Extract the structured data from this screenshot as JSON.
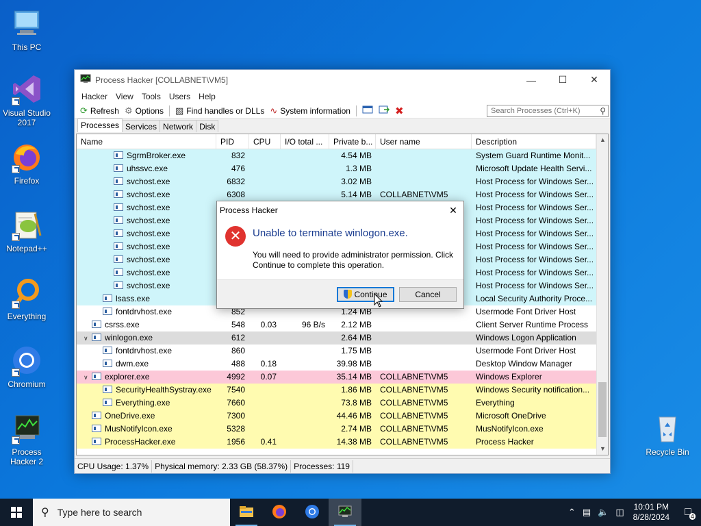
{
  "desktop": {
    "icons": [
      {
        "label": "This PC"
      },
      {
        "label": "Visual Studio 2017"
      },
      {
        "label": "Firefox"
      },
      {
        "label": "Notepad++"
      },
      {
        "label": "Everything"
      },
      {
        "label": "Chromium"
      },
      {
        "label": "Process Hacker 2"
      },
      {
        "label": "Recycle Bin"
      }
    ]
  },
  "window": {
    "title": "Process Hacker [COLLABNET\\VM5]",
    "menu": [
      "Hacker",
      "View",
      "Tools",
      "Users",
      "Help"
    ],
    "toolbar": {
      "refresh": "Refresh",
      "options": "Options",
      "find_handles": "Find handles or DLLs",
      "system_info": "System information"
    },
    "search_placeholder": "Search Processes (Ctrl+K)",
    "tabs": [
      "Processes",
      "Services",
      "Network",
      "Disk"
    ],
    "columns": [
      "Name",
      "PID",
      "CPU",
      "I/O total ...",
      "Private b...",
      "User name",
      "Description"
    ],
    "rows": [
      {
        "name": "SgrmBroker.exe",
        "pid": "832",
        "cpu": "",
        "io": "",
        "priv": "4.54 MB",
        "user": "",
        "desc": "System Guard Runtime Monit...",
        "indent": 3,
        "color": "#cff5fa"
      },
      {
        "name": "uhssvc.exe",
        "pid": "476",
        "cpu": "",
        "io": "",
        "priv": "1.3 MB",
        "user": "",
        "desc": "Microsoft Update Health Servi...",
        "indent": 3,
        "color": "#cff5fa"
      },
      {
        "name": "svchost.exe",
        "pid": "6832",
        "cpu": "",
        "io": "",
        "priv": "3.02 MB",
        "user": "",
        "desc": "Host Process for Windows Ser...",
        "indent": 3,
        "color": "#cff5fa"
      },
      {
        "name": "svchost.exe",
        "pid": "6308",
        "cpu": "",
        "io": "",
        "priv": "5.14 MB",
        "user": "COLLABNET\\VM5",
        "desc": "Host Process for Windows Ser...",
        "indent": 3,
        "color": "#cff5fa"
      },
      {
        "name": "svchost.exe",
        "pid": "",
        "cpu": "",
        "io": "",
        "priv": "",
        "user": "",
        "desc": "Host Process for Windows Ser...",
        "indent": 3,
        "color": "#cff5fa"
      },
      {
        "name": "svchost.exe",
        "pid": "",
        "cpu": "",
        "io": "",
        "priv": "",
        "user": "",
        "desc": "Host Process for Windows Ser...",
        "indent": 3,
        "color": "#cff5fa"
      },
      {
        "name": "svchost.exe",
        "pid": "",
        "cpu": "",
        "io": "",
        "priv": "",
        "user": "",
        "desc": "Host Process for Windows Ser...",
        "indent": 3,
        "color": "#cff5fa"
      },
      {
        "name": "svchost.exe",
        "pid": "",
        "cpu": "",
        "io": "",
        "priv": "",
        "user": "",
        "desc": "Host Process for Windows Ser...",
        "indent": 3,
        "color": "#cff5fa"
      },
      {
        "name": "svchost.exe",
        "pid": "",
        "cpu": "",
        "io": "",
        "priv": "",
        "user": "",
        "desc": "Host Process for Windows Ser...",
        "indent": 3,
        "color": "#cff5fa"
      },
      {
        "name": "svchost.exe",
        "pid": "",
        "cpu": "",
        "io": "",
        "priv": "",
        "user": "",
        "desc": "Host Process for Windows Ser...",
        "indent": 3,
        "color": "#cff5fa"
      },
      {
        "name": "svchost.exe",
        "pid": "",
        "cpu": "",
        "io": "",
        "priv": "",
        "user": "",
        "desc": "Host Process for Windows Ser...",
        "indent": 3,
        "color": "#cff5fa"
      },
      {
        "name": "lsass.exe",
        "pid": "",
        "cpu": "",
        "io": "",
        "priv": "",
        "user": "",
        "desc": "Local Security Authority Proce...",
        "indent": 2,
        "color": "#cff5fa"
      },
      {
        "name": "fontdrvhost.exe",
        "pid": "852",
        "cpu": "",
        "io": "",
        "priv": "1.24 MB",
        "user": "",
        "desc": "Usermode Font Driver Host",
        "indent": 2,
        "color": "#ffffff"
      },
      {
        "name": "csrss.exe",
        "pid": "548",
        "cpu": "0.03",
        "io": "96 B/s",
        "priv": "2.12 MB",
        "user": "",
        "desc": "Client Server Runtime Process",
        "indent": 1,
        "color": "#ffffff"
      },
      {
        "name": "winlogon.exe",
        "pid": "612",
        "cpu": "",
        "io": "",
        "priv": "2.64 MB",
        "user": "",
        "desc": "Windows Logon Application",
        "indent": 1,
        "color": "#dcdcdc",
        "expand": true
      },
      {
        "name": "fontdrvhost.exe",
        "pid": "860",
        "cpu": "",
        "io": "",
        "priv": "1.75 MB",
        "user": "",
        "desc": "Usermode Font Driver Host",
        "indent": 2,
        "color": "#ffffff"
      },
      {
        "name": "dwm.exe",
        "pid": "488",
        "cpu": "0.18",
        "io": "",
        "priv": "39.98 MB",
        "user": "",
        "desc": "Desktop Window Manager",
        "indent": 2,
        "color": "#ffffff"
      },
      {
        "name": "explorer.exe",
        "pid": "4992",
        "cpu": "0.07",
        "io": "",
        "priv": "35.14 MB",
        "user": "COLLABNET\\VM5",
        "desc": "Windows Explorer",
        "indent": 1,
        "color": "#fcc8d8",
        "expand": true
      },
      {
        "name": "SecurityHealthSystray.exe",
        "pid": "7540",
        "cpu": "",
        "io": "",
        "priv": "1.86 MB",
        "user": "COLLABNET\\VM5",
        "desc": "Windows Security notification...",
        "indent": 2,
        "color": "#fffbb0"
      },
      {
        "name": "Everything.exe",
        "pid": "7660",
        "cpu": "",
        "io": "",
        "priv": "73.8 MB",
        "user": "COLLABNET\\VM5",
        "desc": "Everything",
        "indent": 2,
        "color": "#fffbb0"
      },
      {
        "name": "OneDrive.exe",
        "pid": "7300",
        "cpu": "",
        "io": "",
        "priv": "44.46 MB",
        "user": "COLLABNET\\VM5",
        "desc": "Microsoft OneDrive",
        "indent": 1,
        "color": "#fffbb0"
      },
      {
        "name": "MusNotifyIcon.exe",
        "pid": "5328",
        "cpu": "",
        "io": "",
        "priv": "2.74 MB",
        "user": "COLLABNET\\VM5",
        "desc": "MusNotifyIcon.exe",
        "indent": 1,
        "color": "#fffbb0"
      },
      {
        "name": "ProcessHacker.exe",
        "pid": "1956",
        "cpu": "0.41",
        "io": "",
        "priv": "14.38 MB",
        "user": "COLLABNET\\VM5",
        "desc": "Process Hacker",
        "indent": 1,
        "color": "#fffbb0"
      }
    ],
    "status": {
      "cpu": "CPU Usage: 1.37%",
      "memory": "Physical memory: 2.33 GB (58.37%)",
      "processes": "Processes: 119"
    }
  },
  "dialog": {
    "title": "Process Hacker",
    "main": "Unable to terminate winlogon.exe.",
    "sub": "You will need to provide administrator permission. Click Continue to complete this operation.",
    "continue": "Continue",
    "cancel": "Cancel"
  },
  "taskbar": {
    "search_placeholder": "Type here to search",
    "time": "10:01 PM",
    "date": "8/28/2024",
    "notifications": "4"
  }
}
